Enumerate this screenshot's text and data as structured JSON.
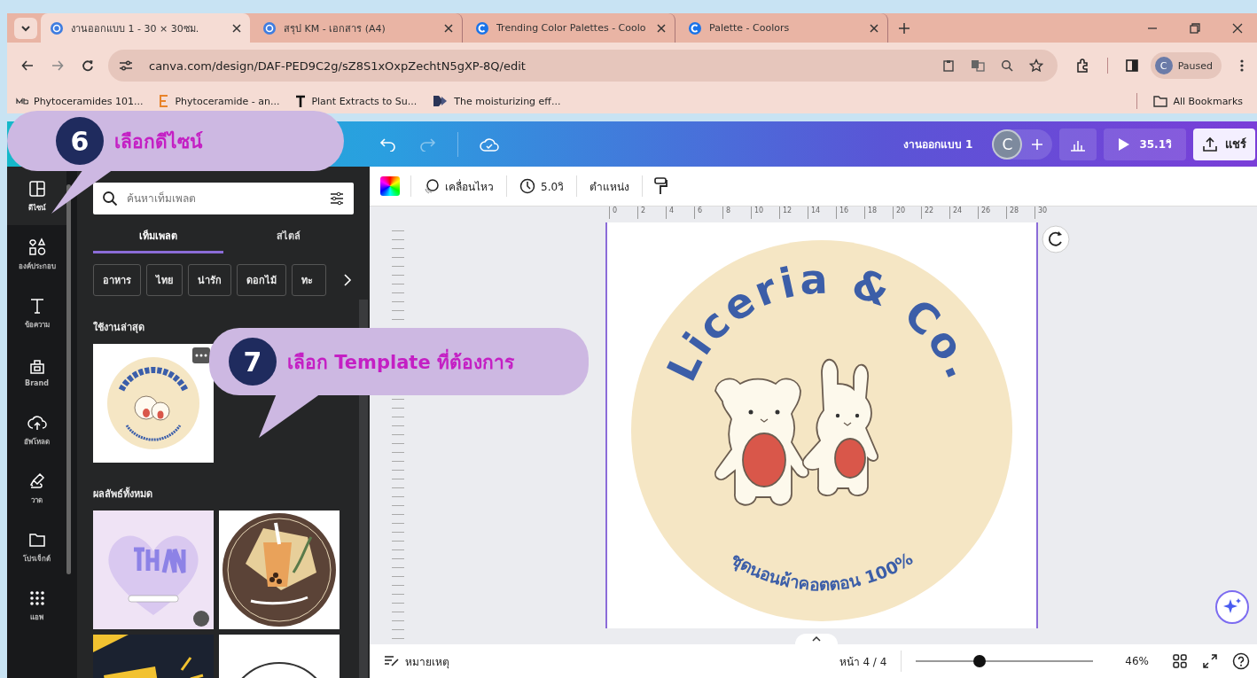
{
  "browser": {
    "tabs": [
      {
        "kind": "canva",
        "title": "งานออกแบบ 1 - 30 × 30ซม.",
        "selected": true
      },
      {
        "kind": "canva",
        "title": "สรุป KM - เอกสาร (A4)",
        "selected": false
      },
      {
        "kind": "coolors",
        "title": "Trending Color Palettes - Coolo",
        "selected": false
      },
      {
        "kind": "coolors",
        "title": "Palette - Coolors",
        "selected": false
      }
    ],
    "url": "canva.com/design/DAF-PED9C2g/sZ8S1xOxpZechtN5gXP-8Q/edit",
    "profile": {
      "initial": "C",
      "label": "Paused"
    },
    "bookmarks": [
      {
        "kind": "mbg",
        "label": "Phytoceramides 101..."
      },
      {
        "kind": "e",
        "label": "Phytoceramide - an..."
      },
      {
        "kind": "t",
        "label": "Plant Extracts to Su..."
      },
      {
        "kind": "play",
        "label": "The moisturizing eff..."
      }
    ],
    "all_bookmarks": "All Bookmarks"
  },
  "editor": {
    "design_title": "งานออกแบบ 1",
    "avatar": "C",
    "play_time": "35.1วิ",
    "share": "แชร์"
  },
  "sidebar": {
    "items": [
      {
        "kind": "design",
        "label": "ดีไซน์",
        "selected": true
      },
      {
        "kind": "elements",
        "label": "องค์ประกอบ",
        "selected": false
      },
      {
        "kind": "text",
        "label": "ข้อความ",
        "selected": false
      },
      {
        "kind": "brand",
        "label": "Brand",
        "selected": false
      },
      {
        "kind": "upload",
        "label": "อัพโหลด",
        "selected": false
      },
      {
        "kind": "draw",
        "label": "วาด",
        "selected": false
      },
      {
        "kind": "projects",
        "label": "โปรเจ็กต์",
        "selected": false
      },
      {
        "kind": "apps",
        "label": "แอพ",
        "selected": false
      }
    ]
  },
  "panel": {
    "search_placeholder": "ค้นหาเท็มเพลต",
    "tabs": [
      {
        "label": "เท็มเพลต",
        "selected": true
      },
      {
        "label": "สไตล์",
        "selected": false
      }
    ],
    "chips": [
      "อาหาร",
      "ไทย",
      "น่ารัก",
      "ดอกไม้",
      "ทะ"
    ],
    "recent_heading": "ใช้งานล่าสุด",
    "all_results_heading": "ผลลัพธ์ทั้งหมด",
    "results": [
      {
        "kind": "thank-you"
      },
      {
        "kind": "tea"
      },
      {
        "kind": "dark"
      },
      {
        "kind": "outline"
      }
    ]
  },
  "toolbar": {
    "animate": "เคลื่อนไหว",
    "duration": "5.0วิ",
    "position": "ตำแหน่ง"
  },
  "ruler": [
    "0",
    "2",
    "4",
    "6",
    "8",
    "10",
    "12",
    "14",
    "16",
    "18",
    "20",
    "22",
    "24",
    "26",
    "28",
    "30"
  ],
  "design": {
    "title": "Liceria & Co.",
    "subtitle": "ชุดนอนผ้าคอตตอน 100%"
  },
  "bottom_bar": {
    "notes": "หมายเหตุ",
    "page": "หน้า 4 / 4",
    "zoom": {
      "level": 0.36,
      "reading": "46%"
    }
  },
  "callouts": [
    {
      "number": "6",
      "text": "เลือกดีไซน์"
    },
    {
      "number": "7",
      "text": "เลือก Template ที่ต้องการ"
    }
  ]
}
